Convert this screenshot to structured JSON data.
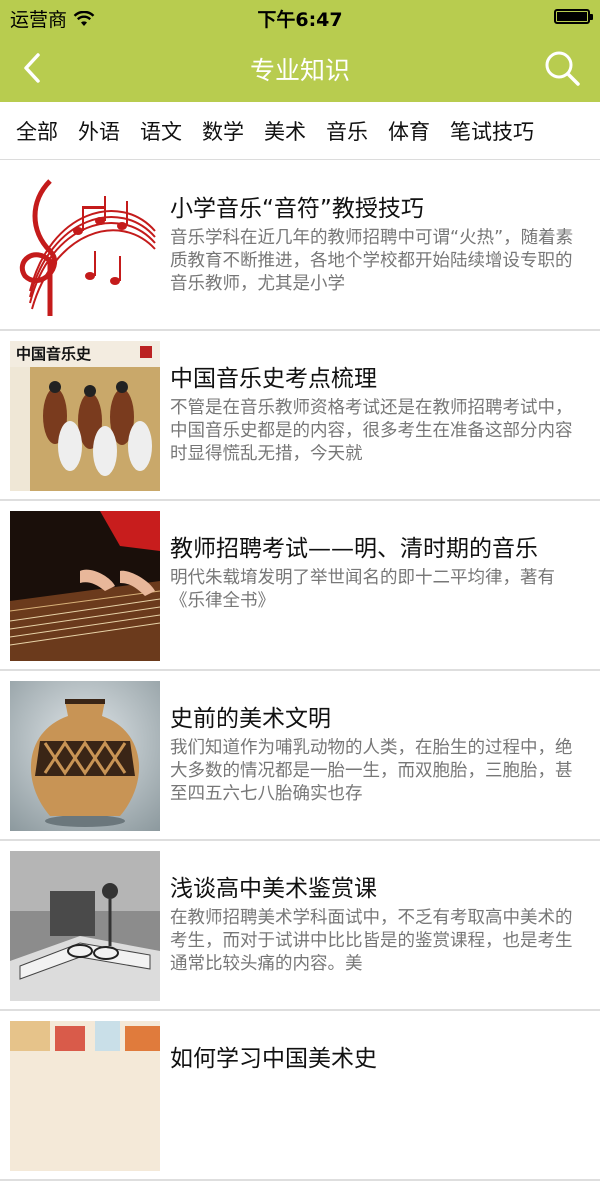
{
  "status_bar": {
    "carrier": "运营商",
    "time": "下午6:47"
  },
  "nav": {
    "title": "专业知识",
    "back_icon": "chevron-left-icon",
    "search_icon": "search-icon"
  },
  "tabs": [
    "全部",
    "外语",
    "语文",
    "数学",
    "美术",
    "音乐",
    "体育",
    "笔试技巧"
  ],
  "articles": [
    {
      "title": "小学音乐“音符”教授技巧",
      "desc": "音乐学科在近几年的教师招聘中可谓“火热”，随着素质教育不断推进，各地个学校都开始陆续增设专职的音乐教师，尤其是小学"
    },
    {
      "title": "中国音乐史考点梳理",
      "desc": "不管是在音乐教师资格考试还是在教师招聘考试中，中国音乐史都是的内容，很多考生在准备这部分内容时显得慌乱无措，今天就",
      "thumb_text": "中国音乐史"
    },
    {
      "title": "教师招聘考试——明、清时期的音乐",
      "desc": "明代朱载堉发明了举世闻名的即十二平均律，著有《乐律全书》"
    },
    {
      "title": "史前的美术文明",
      "desc": "我们知道作为哺乳动物的人类，在胎生的过程中，绝大多数的情况都是一胎一生，而双胞胎，三胞胎，甚至四五六七八胎确实也存"
    },
    {
      "title": "浅谈高中美术鉴赏课",
      "desc": "在教师招聘美术学科面试中，不乏有考取高中美术的考生，而对于试讲中比比皆是的鉴赏课程，也是考生通常比较头痛的内容。美"
    },
    {
      "title": "如何学习中国美术史",
      "desc": ""
    }
  ],
  "colors": {
    "brand_green": "#b8cc4f",
    "desc_gray": "#777777"
  }
}
